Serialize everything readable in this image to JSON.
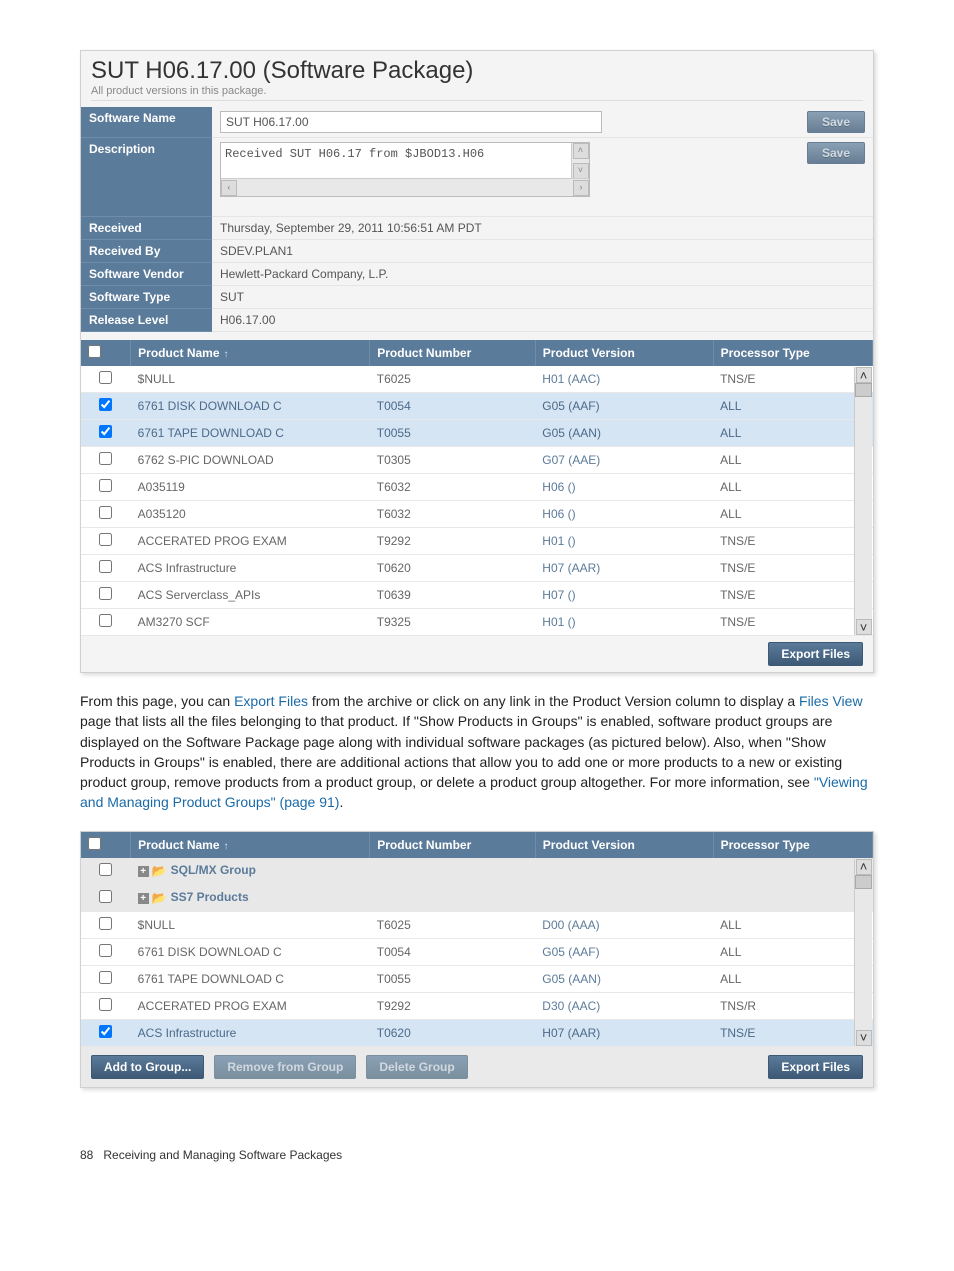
{
  "header": {
    "title": "SUT H06.17.00 (Software Package)",
    "subtitle": "All product versions in this package."
  },
  "labels": {
    "software_name": "Software Name",
    "description": "Description",
    "received": "Received",
    "received_by": "Received By",
    "software_vendor": "Software Vendor",
    "software_type": "Software Type",
    "release_level": "Release Level",
    "save": "Save"
  },
  "values": {
    "software_name": "SUT H06.17.00",
    "description": "Received SUT H06.17 from $JBOD13.H06",
    "received": "Thursday, September 29, 2011 10:56:51 AM PDT",
    "received_by": "SDEV.PLAN1",
    "software_vendor": "Hewlett-Packard Company, L.P.",
    "software_type": "SUT",
    "release_level": "H06.17.00"
  },
  "grid1": {
    "columns": {
      "name": "Product Name",
      "number": "Product Number",
      "version": "Product Version",
      "processor": "Processor Type"
    },
    "rows": [
      {
        "checked": false,
        "name": "$NULL",
        "number": "T6025",
        "version": "H01 (AAC)",
        "processor": "TNS/E"
      },
      {
        "checked": true,
        "name": "6761 DISK DOWNLOAD C",
        "number": "T0054",
        "version": "G05 (AAF)",
        "processor": "ALL"
      },
      {
        "checked": true,
        "name": "6761 TAPE DOWNLOAD C",
        "number": "T0055",
        "version": "G05 (AAN)",
        "processor": "ALL"
      },
      {
        "checked": false,
        "name": "6762 S-PIC DOWNLOAD",
        "number": "T0305",
        "version": "G07 (AAE)",
        "processor": "ALL"
      },
      {
        "checked": false,
        "name": "A035119",
        "number": "T6032",
        "version": "H06 ()",
        "processor": "ALL"
      },
      {
        "checked": false,
        "name": "A035120",
        "number": "T6032",
        "version": "H06 ()",
        "processor": "ALL"
      },
      {
        "checked": false,
        "name": "ACCERATED PROG EXAM",
        "number": "T9292",
        "version": "H01 ()",
        "processor": "TNS/E"
      },
      {
        "checked": false,
        "name": "ACS Infrastructure",
        "number": "T0620",
        "version": "H07 (AAR)",
        "processor": "TNS/E"
      },
      {
        "checked": false,
        "name": "ACS Serverclass_APIs",
        "number": "T0639",
        "version": "H07 ()",
        "processor": "TNS/E"
      },
      {
        "checked": false,
        "name": "AM3270 SCF",
        "number": "T9325",
        "version": "H01 ()",
        "processor": "TNS/E"
      }
    ],
    "export_label": "Export Files"
  },
  "paragraph": {
    "pre1": "From this page, you can ",
    "link1": "Export Files",
    "mid1": " from the archive or click on any link in the Product Version column to display a ",
    "link2": "Files View",
    "mid2": " page that lists all the files belonging to that product. If \"Show Products in Groups\" is enabled, software product groups are displayed on the Software Package page along with individual software packages (as pictured below). Also, when \"Show Products in Groups\" is enabled, there are additional actions that allow you to add one or more products to a new or existing product group, remove products from a product group, or delete a product group altogether. For more information, see ",
    "link3": "\"Viewing and Managing Product Groups\" (page 91)",
    "post": "."
  },
  "grid2": {
    "columns": {
      "name": "Product Name",
      "number": "Product Number",
      "version": "Product Version",
      "processor": "Processor Type"
    },
    "groups": [
      {
        "label": "SQL/MX Group"
      },
      {
        "label": "SS7 Products"
      }
    ],
    "rows": [
      {
        "checked": false,
        "name": "$NULL",
        "number": "T6025",
        "version": "D00 (AAA)",
        "processor": "ALL"
      },
      {
        "checked": false,
        "name": "6761 DISK DOWNLOAD C",
        "number": "T0054",
        "version": "G05 (AAF)",
        "processor": "ALL"
      },
      {
        "checked": false,
        "name": "6761 TAPE DOWNLOAD C",
        "number": "T0055",
        "version": "G05 (AAN)",
        "processor": "ALL"
      },
      {
        "checked": false,
        "name": "ACCERATED PROG EXAM",
        "number": "T9292",
        "version": "D30 (AAC)",
        "processor": "TNS/R"
      },
      {
        "checked": true,
        "name": "ACS Infrastructure",
        "number": "T0620",
        "version": "H07 (AAR)",
        "processor": "TNS/E"
      }
    ],
    "buttons": {
      "add": "Add to Group...",
      "remove": "Remove from Group",
      "delete": "Delete Group",
      "export": "Export Files"
    }
  },
  "footer": {
    "page": "88",
    "chapter": "Receiving and Managing Software Packages"
  }
}
